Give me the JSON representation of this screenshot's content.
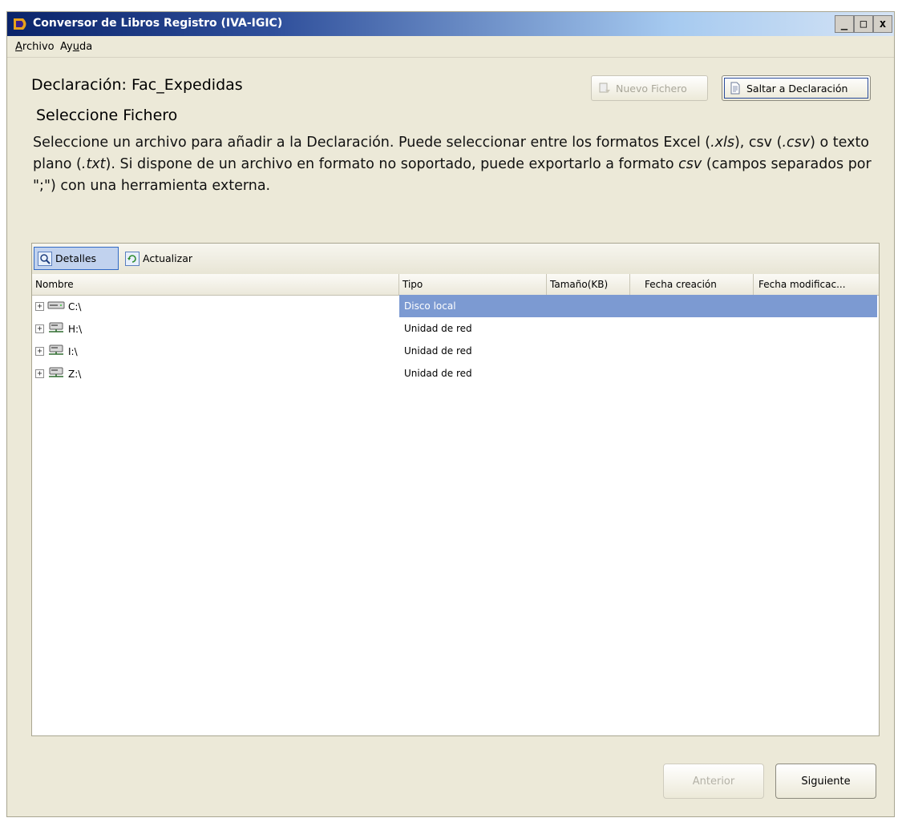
{
  "window": {
    "title": "Conversor de Libros Registro (IVA-IGIC)",
    "controls": {
      "minimize": "_",
      "maximize": "□",
      "close": "x"
    }
  },
  "menu": [
    {
      "label": "Archivo",
      "accel": "A"
    },
    {
      "label": "Ayuda",
      "accel": "u"
    }
  ],
  "header": {
    "declaration": "Declaración: Fac_Expedidas",
    "section": "Seleccione Fichero",
    "description_parts": [
      "Seleccione un archivo para añadir a la Declaración. Puede seleccionar entre los formatos Excel (",
      ".xls",
      "), csv (",
      ".csv",
      ") o texto plano (",
      ".txt",
      "). Si dispone de un archivo en formato no soportado, puede exportarlo a formato ",
      "csv",
      " (campos separados por \";\") con una herramienta externa."
    ]
  },
  "actions": {
    "new_file": "Nuevo Fichero",
    "jump": "Saltar a Declaración"
  },
  "browser": {
    "toolbar": {
      "details": "Detalles",
      "refresh": "Actualizar"
    },
    "columns": [
      "Nombre",
      "Tipo",
      "Tamaño(KB)",
      "Fecha creación",
      "Fecha modificac..."
    ],
    "rows": [
      {
        "name": "C:\\",
        "type": "Disco local",
        "icon": "local-disk-icon",
        "selected": true
      },
      {
        "name": "H:\\",
        "type": "Unidad de red",
        "icon": "network-drive-icon",
        "selected": false
      },
      {
        "name": "I:\\",
        "type": "Unidad de red",
        "icon": "network-drive-icon",
        "selected": false
      },
      {
        "name": "Z:\\",
        "type": "Unidad de red",
        "icon": "network-drive-icon",
        "selected": false
      }
    ]
  },
  "footer": {
    "previous": "Anterior",
    "next": "Siguiente"
  },
  "colors": {
    "selection": "#7c9ad2",
    "title_bar": "#0a246a",
    "window_bg": "#ece9d8"
  }
}
